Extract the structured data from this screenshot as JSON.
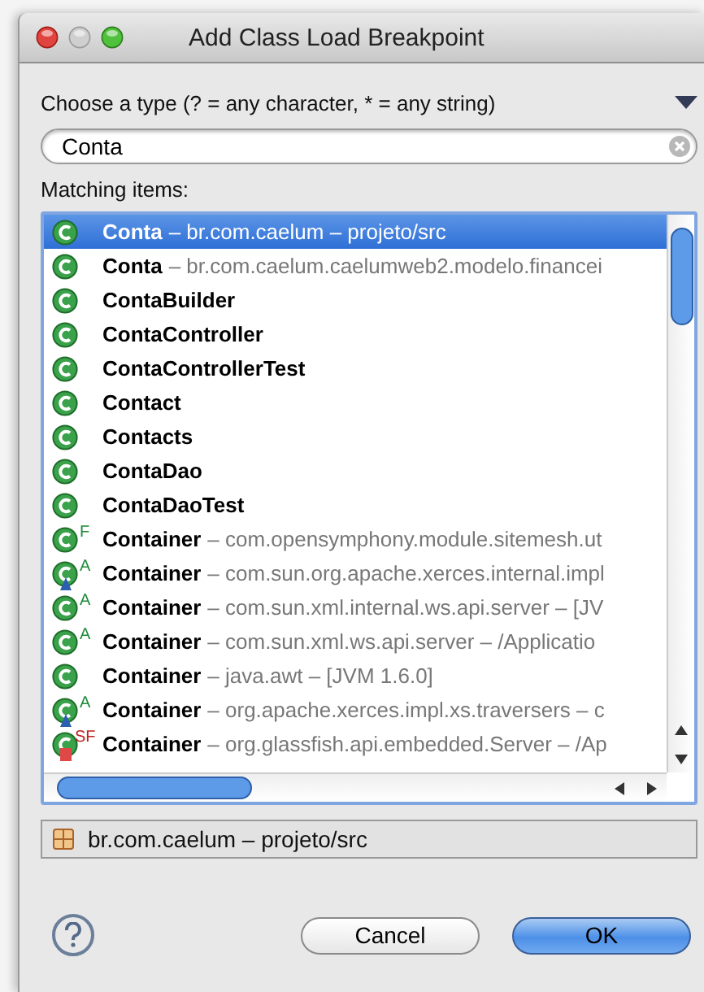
{
  "window": {
    "title": "Add Class Load Breakpoint"
  },
  "type_prompt": "Choose a type (? = any character, * = any string)",
  "search": {
    "value": "Conta"
  },
  "list_label": "Matching items:",
  "items": [
    {
      "kind": "plain",
      "name": "Conta",
      "detail": "– br.com.caelum – projeto/src",
      "selected": true
    },
    {
      "kind": "plain",
      "name": "Conta",
      "detail": "– br.com.caelum.caelumweb2.modelo.financei",
      "selected": false
    },
    {
      "kind": "plain",
      "name": "ContaBuilder",
      "selected": false
    },
    {
      "kind": "plain",
      "name": "ContaController",
      "selected": false
    },
    {
      "kind": "plain",
      "name": "ContaControllerTest",
      "selected": false
    },
    {
      "kind": "plain",
      "name": "Contact",
      "selected": false
    },
    {
      "kind": "plain",
      "name": "Contacts",
      "selected": false
    },
    {
      "kind": "plain",
      "name": "ContaDao",
      "selected": false
    },
    {
      "kind": "plain",
      "name": "ContaDaoTest",
      "selected": false
    },
    {
      "kind": "plain",
      "name": "Container",
      "detail": "– com.opensymphony.module.sitemesh.ut",
      "modifier": "F",
      "selected": false
    },
    {
      "kind": "triangle",
      "name": "Container",
      "detail": "– com.sun.org.apache.xerces.internal.impl",
      "modifier": "A",
      "selected": false
    },
    {
      "kind": "plain",
      "name": "Container",
      "detail": "– com.sun.xml.internal.ws.api.server – [JV",
      "modifier": "A",
      "selected": false
    },
    {
      "kind": "plain",
      "name": "Container",
      "detail": "– com.sun.xml.ws.api.server – /Applicatio",
      "modifier": "A",
      "selected": false
    },
    {
      "kind": "plain",
      "name": "Container",
      "detail": "– java.awt – [JVM 1.6.0]",
      "selected": false
    },
    {
      "kind": "triangle",
      "name": "Container",
      "detail": "– org.apache.xerces.impl.xs.traversers – c",
      "modifier": "A",
      "selected": false
    },
    {
      "kind": "square",
      "name": "Container",
      "detail": "– org.glassfish.api.embedded.Server – /Ap",
      "modifier": "SF",
      "selected": false
    }
  ],
  "status": {
    "text": "br.com.caelum – projeto/src"
  },
  "buttons": [
    {
      "label": "Cancel",
      "kind": "normal"
    },
    {
      "label": "OK",
      "kind": "default"
    }
  ]
}
